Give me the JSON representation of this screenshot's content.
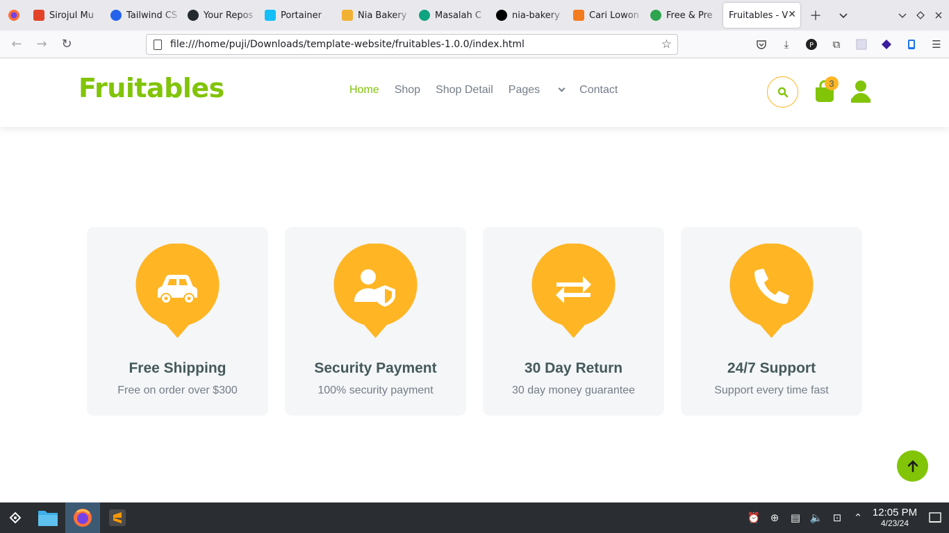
{
  "browser": {
    "tabs": [
      {
        "title": "Sirojul Mu",
        "color": "#e24329"
      },
      {
        "title": "Tailwind CS",
        "color": "#2563eb"
      },
      {
        "title": "Your Repos",
        "color": "#24292f"
      },
      {
        "title": "Portainer",
        "color": "#13bef9"
      },
      {
        "title": "Nia Bakery",
        "color": "#f2b134"
      },
      {
        "title": "Masalah C",
        "color": "#10a37f"
      },
      {
        "title": "nia-bakery",
        "color": "#000000"
      },
      {
        "title": "Cari Lowon",
        "color": "#f47c20"
      },
      {
        "title": "Free & Pre",
        "color": "#2ea44f"
      }
    ],
    "active_tab": "Fruitables - V",
    "url": "file:///home/puji/Downloads/template-website/fruitables-1.0.0/index.html"
  },
  "site": {
    "logo": "Fruitables",
    "menu": {
      "home": "Home",
      "shop": "Shop",
      "shop_detail": "Shop Detail",
      "pages": "Pages",
      "contact": "Contact"
    },
    "cart_count": "3",
    "accent_green": "#81c408",
    "accent_orange": "#ffb524"
  },
  "features": [
    {
      "title": "Free Shipping",
      "subtitle": "Free on order over $300",
      "icon": "car-icon"
    },
    {
      "title": "Security Payment",
      "subtitle": "100% security payment",
      "icon": "user-shield-icon"
    },
    {
      "title": "30 Day Return",
      "subtitle": "30 day money guarantee",
      "icon": "exchange-icon"
    },
    {
      "title": "24/7 Support",
      "subtitle": "Support every time fast",
      "icon": "phone-icon"
    }
  ],
  "taskbar": {
    "time": "12:05 PM",
    "date": "4/23/24"
  }
}
